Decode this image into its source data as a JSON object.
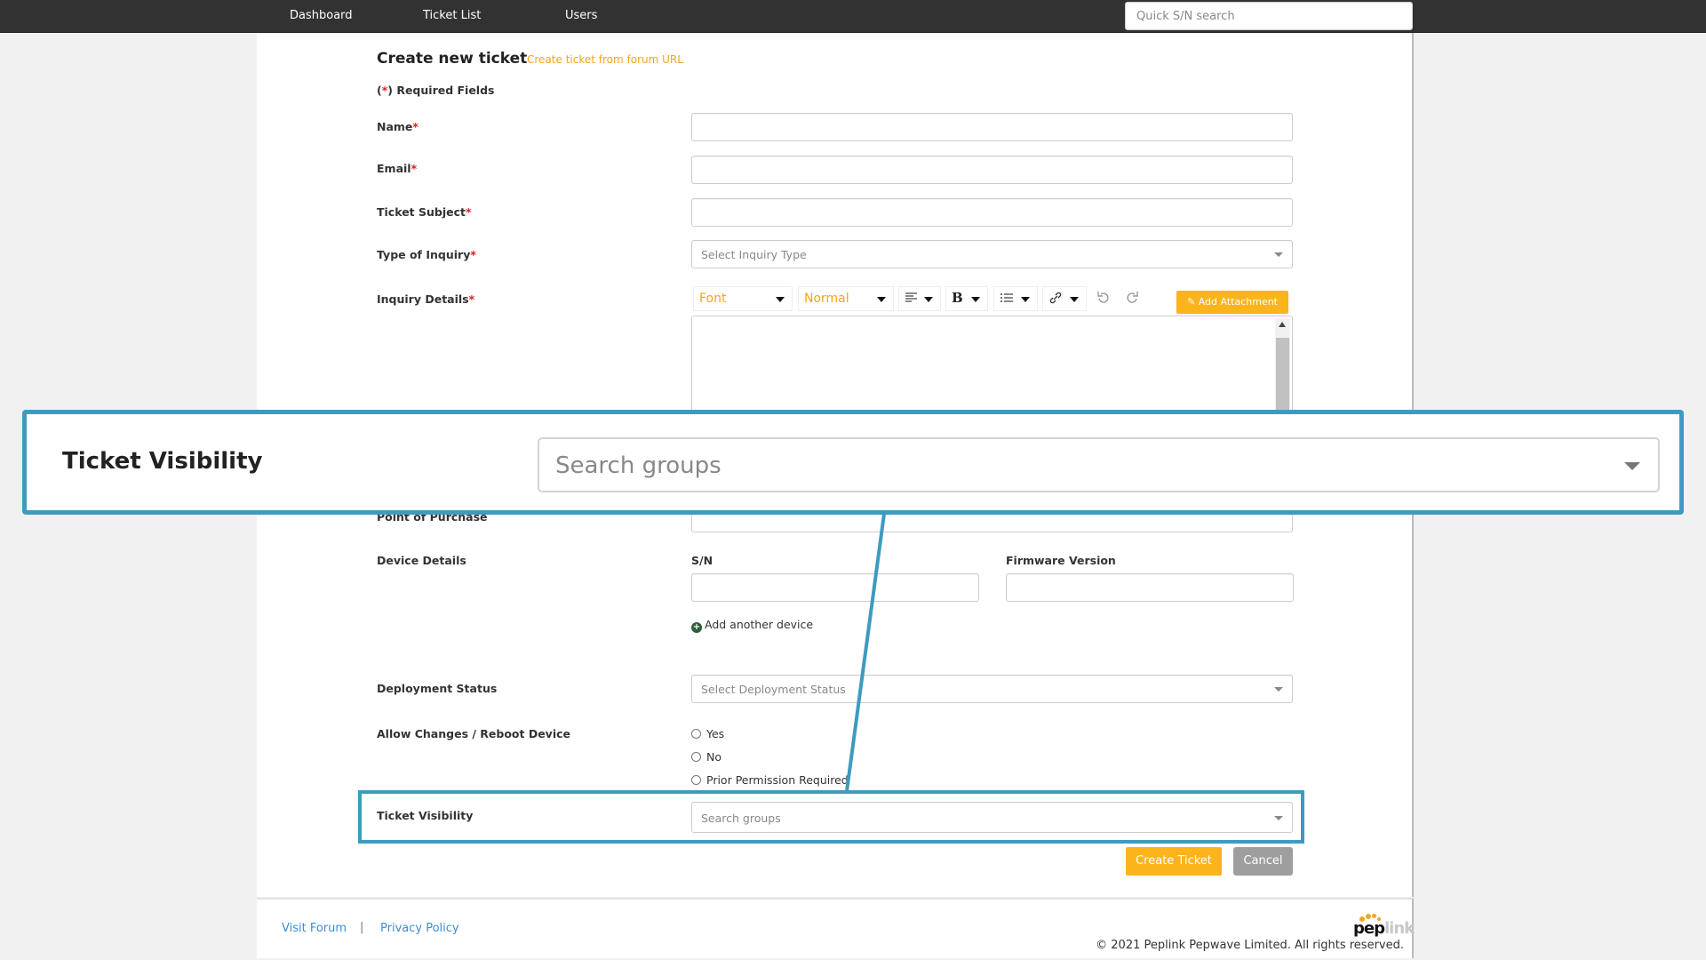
{
  "nav": {
    "items": [
      {
        "label": "Dashboard"
      },
      {
        "label": "Ticket List"
      },
      {
        "label": "Users"
      }
    ],
    "quick_search_placeholder": "Quick S/N search"
  },
  "header": {
    "title": "Create new ticket",
    "forum_link": "Create ticket from forum URL",
    "required_note_open": "(",
    "required_star": "*",
    "required_note_close": ") Required Fields"
  },
  "form": {
    "required_marker": "*",
    "name_label": "Name",
    "email_label": "Email",
    "subject_label": "Ticket Subject",
    "inquiry_type_label": "Type of Inquiry",
    "inquiry_type_placeholder": "Select Inquiry Type",
    "inquiry_details_label": "Inquiry Details",
    "editor_toolbar": {
      "font": "Font",
      "size": "Normal",
      "align_icon": "align-icon",
      "bold_icon": "bold-icon",
      "bold_glyph": "B",
      "list_icon": "list-icon",
      "link_icon": "link-icon",
      "undo_icon": "undo-icon",
      "redo_icon": "redo-icon",
      "attach_label": "Add Attachment"
    },
    "point_of_purchase_label": "Point of Purchase",
    "device_details_label": "Device Details",
    "sn_label": "S/N",
    "firmware_label": "Firmware Version",
    "add_device_label": "Add another device",
    "deployment_label": "Deployment Status",
    "deployment_placeholder": "Select Deployment Status",
    "allow_changes_label": "Allow Changes / Reboot Device",
    "allow_changes_options": [
      "Yes",
      "No",
      "Prior Permission Required"
    ],
    "visibility_label": "Ticket Visibility",
    "visibility_placeholder": "Search groups",
    "create_button": "Create Ticket",
    "cancel_button": "Cancel"
  },
  "callout": {
    "label": "Ticket Visibility",
    "placeholder": "Search groups",
    "color": "#3d9bbf"
  },
  "footer": {
    "visit_forum": "Visit Forum",
    "separator": "|",
    "privacy_policy": "Privacy Policy",
    "logo_pep": "pep",
    "logo_link": "link",
    "copyright": "© 2021 Peplink Pepwave Limited. All rights reserved."
  },
  "colors": {
    "accent": "#fbb41a",
    "link": "#3b8dd6",
    "highlight": "#3d9bbf",
    "required": "#e31b1b"
  }
}
